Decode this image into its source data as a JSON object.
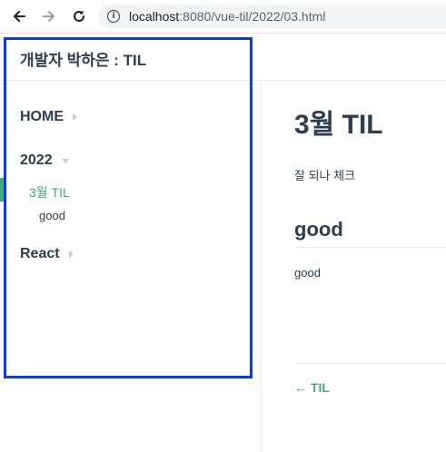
{
  "browser": {
    "url_host": "localhost",
    "url_path": ":8080/vue-til/2022/03.html",
    "info_glyph": "i"
  },
  "navbar": {
    "site_name": "개발자 박하은 : TIL"
  },
  "sidebar": {
    "groups": [
      {
        "label": "HOME",
        "state": "collapsed"
      },
      {
        "label": "2022",
        "state": "expanded"
      },
      {
        "label": "React",
        "state": "collapsed"
      }
    ],
    "active_link": "3월 TIL",
    "sub_link": "good"
  },
  "content": {
    "title": "3월 TIL",
    "intro": "잘 되나 체크",
    "section_heading": "good",
    "section_text": "good",
    "prev_arrow": "←",
    "prev_label": "TIL"
  },
  "colors": {
    "accent": "#3eaf7c",
    "text": "#2c3e50",
    "highlight": "#0a3ce0"
  }
}
